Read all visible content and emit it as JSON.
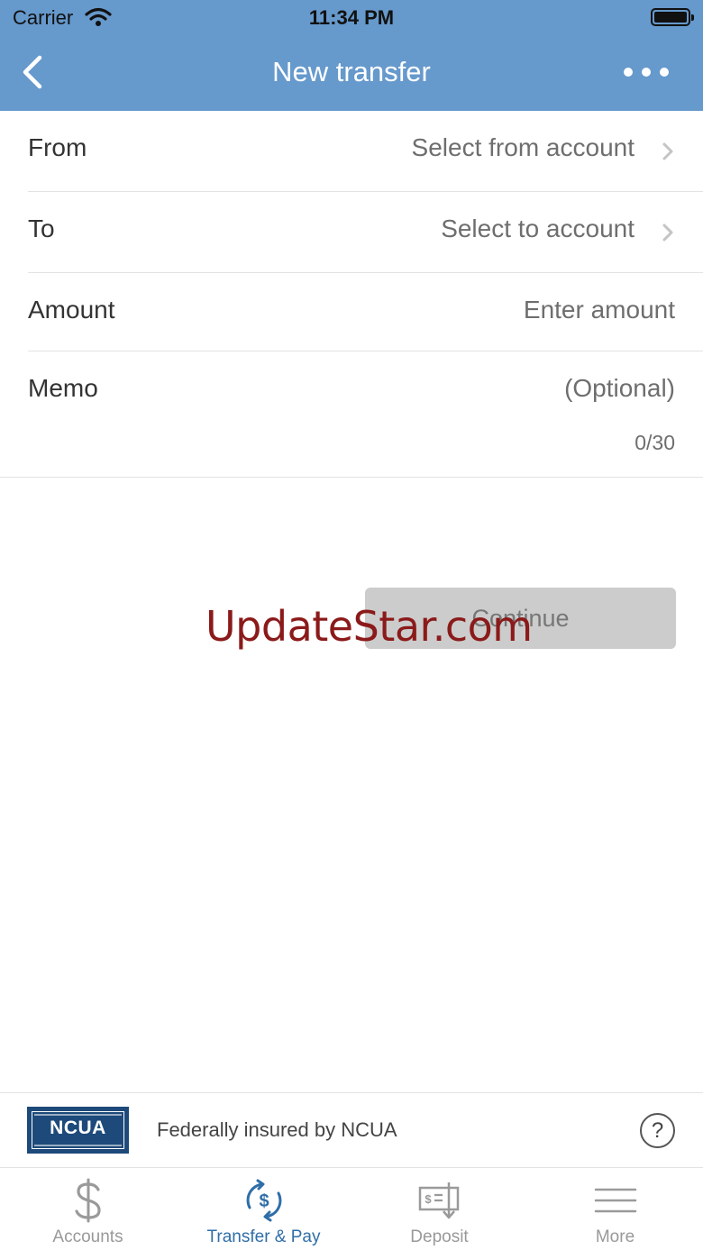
{
  "status_bar": {
    "carrier": "Carrier",
    "time": "11:34 PM"
  },
  "nav": {
    "title": "New transfer",
    "back_icon": "chevron-left-icon",
    "more_icon": "ellipsis-icon"
  },
  "form": {
    "from": {
      "label": "From",
      "value": "Select from account"
    },
    "to": {
      "label": "To",
      "value": "Select to account"
    },
    "amount": {
      "label": "Amount",
      "placeholder": "Enter amount"
    },
    "memo": {
      "label": "Memo",
      "placeholder": "(Optional)",
      "counter": "0/30"
    }
  },
  "continue_label": "Continue",
  "watermark": "UpdateStar.com",
  "footer": {
    "logo_text": "NCUA",
    "insured_text": "Federally insured by NCUA",
    "help_label": "?"
  },
  "tabs": [
    {
      "label": "Accounts",
      "icon": "dollar-icon",
      "active": false
    },
    {
      "label": "Transfer & Pay",
      "icon": "transfer-dollar-icon",
      "active": true
    },
    {
      "label": "Deposit",
      "icon": "check-deposit-icon",
      "active": false
    },
    {
      "label": "More",
      "icon": "menu-icon",
      "active": false
    }
  ],
  "colors": {
    "header": "#6699cc",
    "active_tab": "#2f6ea8",
    "inactive_tab": "#999999",
    "button_disabled": "#cccccc",
    "ncua_blue": "#1d4a7a",
    "watermark": "#8b1a1a"
  }
}
